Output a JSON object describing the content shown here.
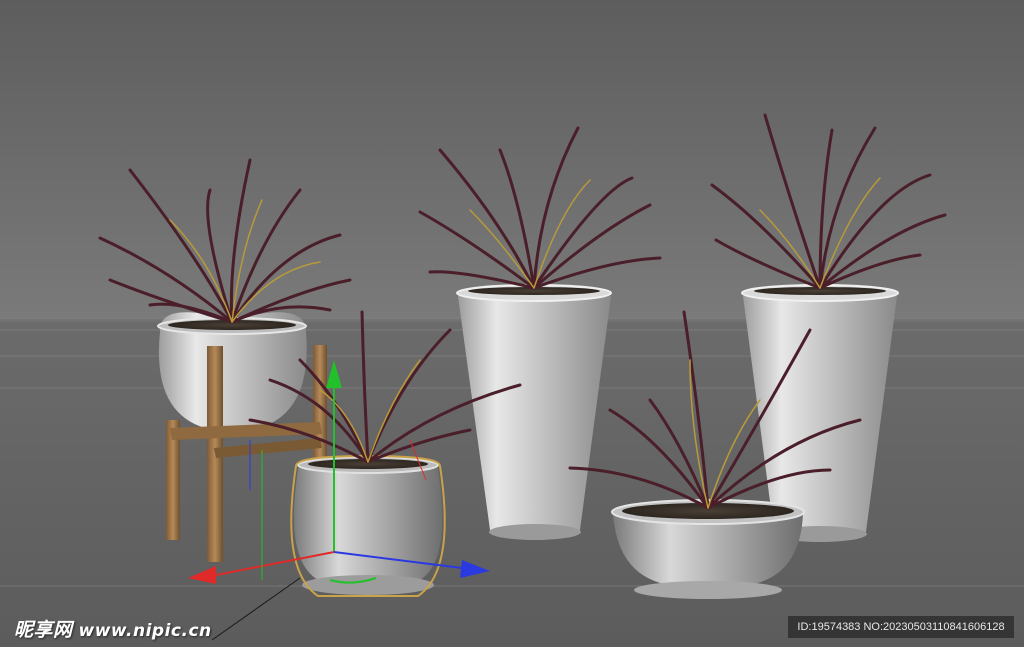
{
  "scene": {
    "background_top": "#5f5f5f",
    "background_horizon": "#7b7b7b",
    "floor_color": "#646464",
    "pot_color": "#c9c9c9",
    "stand_color": "#a07b52",
    "leaf_dark": "#4a1f2a",
    "leaf_accent": "#b89a3a",
    "selection_outline": "#c9a24a",
    "gizmo": {
      "y_axis_color": "#22c02a",
      "x_axis_color": "#e02a2a",
      "z_axis_color": "#2a3ae0"
    }
  },
  "watermark": {
    "brand": "昵享网",
    "site": "www.nipic.cn"
  },
  "id_badge": {
    "text": "ID:19574383 NO:20230503110841606128"
  }
}
